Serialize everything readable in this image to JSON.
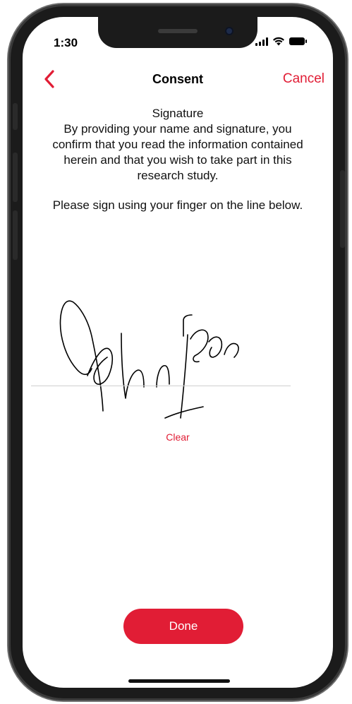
{
  "status_bar": {
    "time": "1:30",
    "icons": [
      "cellular-signal-icon",
      "wifi-icon",
      "battery-icon"
    ]
  },
  "nav": {
    "back_icon": "chevron-left-icon",
    "title": "Consent",
    "cancel_label": "Cancel"
  },
  "content": {
    "heading": "Signature",
    "body": "By providing your name and signature, you confirm that you read the information contained herein and that you wish to take part in this research study.",
    "instruction": "Please sign using your finger on the line below."
  },
  "signature": {
    "clear_label": "Clear"
  },
  "actions": {
    "done_label": "Done"
  },
  "colors": {
    "accent": "#e11d35",
    "text": "#111111",
    "background": "#ffffff"
  }
}
